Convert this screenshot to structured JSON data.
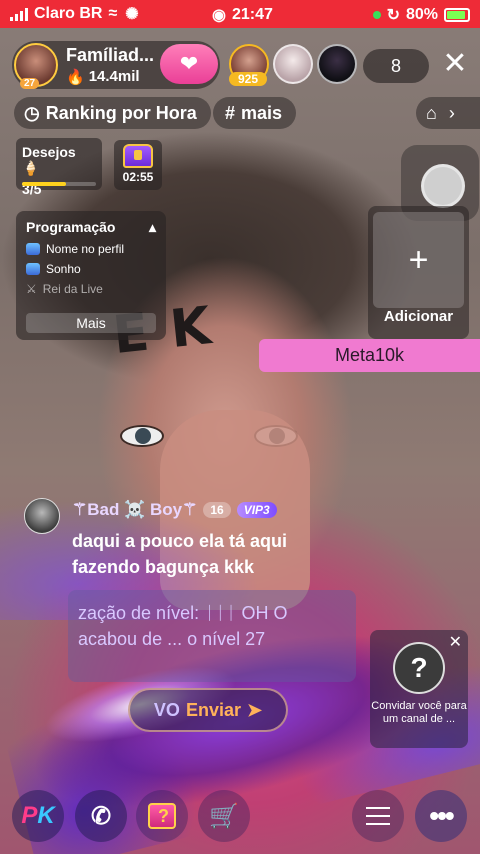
{
  "status_bar": {
    "carrier": "Claro BR",
    "time": "21:47",
    "battery": "80%"
  },
  "host": {
    "name": "Famíliad...",
    "level": "27",
    "fans": "14.4mil"
  },
  "viewers": {
    "top_badge": "925",
    "count": "8"
  },
  "tags": {
    "ranking": "Ranking por Hora",
    "more": "mais"
  },
  "wishes": {
    "title": "Desejos",
    "progress": "3/5",
    "progress_fraction": 0.6
  },
  "chest": {
    "timer": "02:55"
  },
  "programming": {
    "title": "Programação",
    "items": [
      "Nome no perfil",
      "Sonho",
      "Rei da Live"
    ],
    "more_label": "Mais"
  },
  "add_box": {
    "plus": "+",
    "label": "Adicionar"
  },
  "meta": {
    "label": "Meta10k"
  },
  "chat": {
    "username": "⚚Bad ☠️ Boy⚚",
    "level": "16",
    "vip": "VIP3",
    "message": "daqui a pouco ela tá aqui fazendo bagunça kkk",
    "level_up_text": "zação de nível: ᛁᛁᛁ OH O acabou de ... o nível 27"
  },
  "send_button": {
    "label": "Enviar",
    "prefix": "VO"
  },
  "invite": {
    "text": "Convidar você para um canal de ..."
  },
  "bottom_bar": {
    "pk_p": "P",
    "pk_k": "K"
  },
  "colors": {
    "status_bar": "#ee2b37",
    "meta_bar": "#f07ad0",
    "accent_pink": "#ea3f97",
    "send_text": "#ffb25a"
  }
}
